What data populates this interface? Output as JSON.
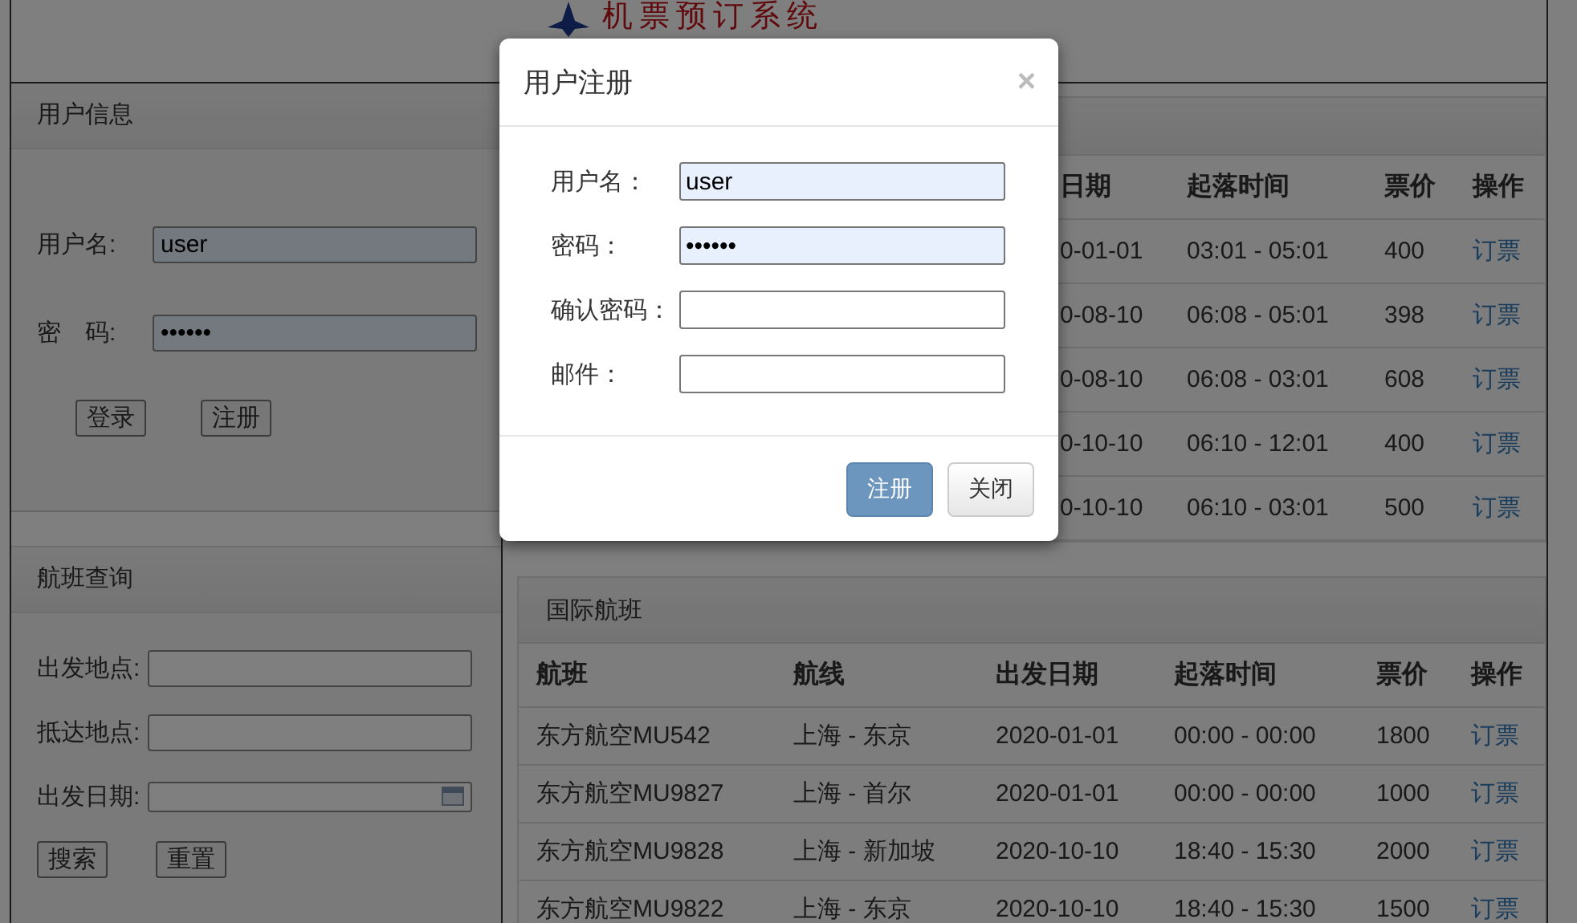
{
  "header": {
    "title": "机票预订系统"
  },
  "user_panel": {
    "title": "用户信息",
    "fields": [
      {
        "label": "用户名:",
        "value": "user",
        "autofilled": true
      },
      {
        "label": "密　码:",
        "value": "••••••",
        "autofilled": true
      }
    ],
    "buttons": [
      "登录",
      "注册"
    ]
  },
  "search_panel": {
    "title": "航班查询",
    "fields": [
      {
        "label": "出发地点:",
        "kind": "text"
      },
      {
        "label": "抵达地点:",
        "kind": "text"
      },
      {
        "label": "出发日期:",
        "kind": "date"
      }
    ],
    "buttons": [
      "搜索",
      "重置"
    ]
  },
  "domestic_table": {
    "columns": [
      "日期",
      "起落时间",
      "票价",
      "操作"
    ],
    "rows": [
      [
        "0-01-01",
        "03:01 - 05:01",
        "400",
        "订票"
      ],
      [
        "0-08-10",
        "06:08 - 05:01",
        "398",
        "订票"
      ],
      [
        "0-08-10",
        "06:08 - 03:01",
        "608",
        "订票"
      ],
      [
        "0-10-10",
        "06:10 - 12:01",
        "400",
        "订票"
      ],
      [
        "0-10-10",
        "06:10 - 03:01",
        "500",
        "订票"
      ]
    ]
  },
  "international_table": {
    "title": "国际航班",
    "columns": [
      "航班",
      "航线",
      "出发日期",
      "起落时间",
      "票价",
      "操作"
    ],
    "rows": [
      [
        "东方航空MU542",
        "上海 - 东京",
        "2020-01-01",
        "00:00 - 00:00",
        "1800",
        "订票"
      ],
      [
        "东方航空MU9827",
        "上海 - 首尔",
        "2020-01-01",
        "00:00 - 00:00",
        "1000",
        "订票"
      ],
      [
        "东方航空MU9828",
        "上海 - 新加坡",
        "2020-10-10",
        "18:40 - 15:30",
        "2000",
        "订票"
      ],
      [
        "东方航空MU9822",
        "上海 - 东京",
        "2020-10-10",
        "18:40 - 15:30",
        "1500",
        "订票"
      ]
    ]
  },
  "dialog": {
    "title": "用户注册",
    "close": "×",
    "fields": [
      {
        "label": "用户名：",
        "value": "user",
        "autofilled": true
      },
      {
        "label": "密码：",
        "value": "••••••",
        "autofilled": true
      },
      {
        "label": "确认密码：",
        "autofilled": false
      },
      {
        "label": "邮件：",
        "autofilled": false
      }
    ],
    "buttons": [
      {
        "label": "注册",
        "kind": "primary"
      },
      {
        "label": "关闭",
        "kind": "default"
      }
    ]
  }
}
